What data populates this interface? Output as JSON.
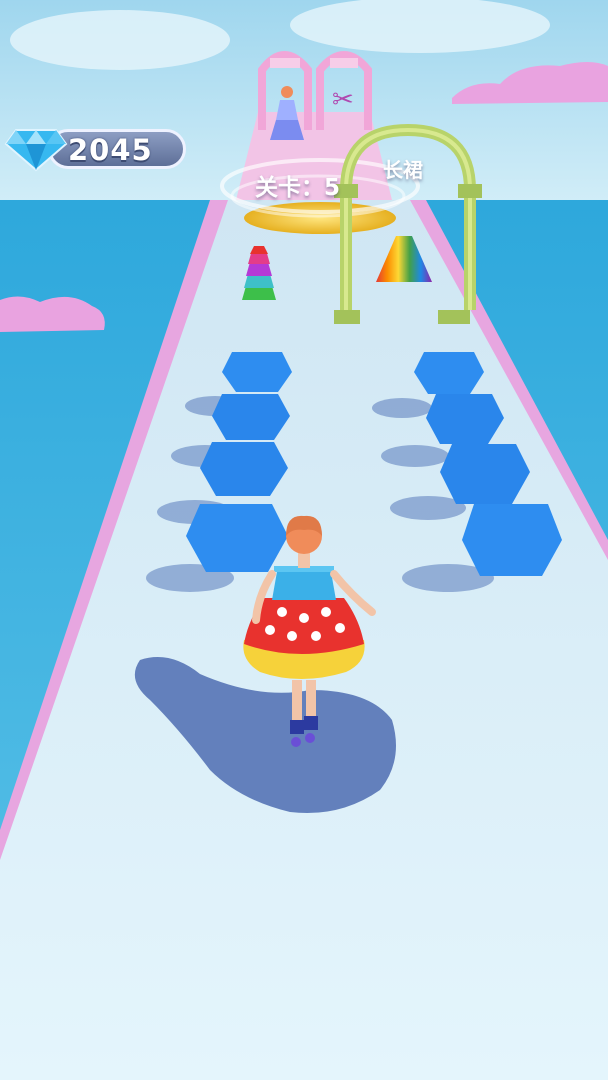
{
  "hud": {
    "gem_count": "2045",
    "level_text": "关卡：5"
  },
  "track": {
    "gate_label": "长裙"
  },
  "icons": {
    "gem": "diamond-icon"
  },
  "colors": {
    "sky_top": "#bfe3f3",
    "sea": "#3fb4e2",
    "track": "#d9f1fb",
    "track_rail": "#e7a6e0",
    "gem_obstacle": "#2e8df0",
    "arch": "#b8d36a",
    "platform": "#f2c534",
    "dress_red": "#e8322e",
    "dress_yellow": "#f6d23a"
  }
}
